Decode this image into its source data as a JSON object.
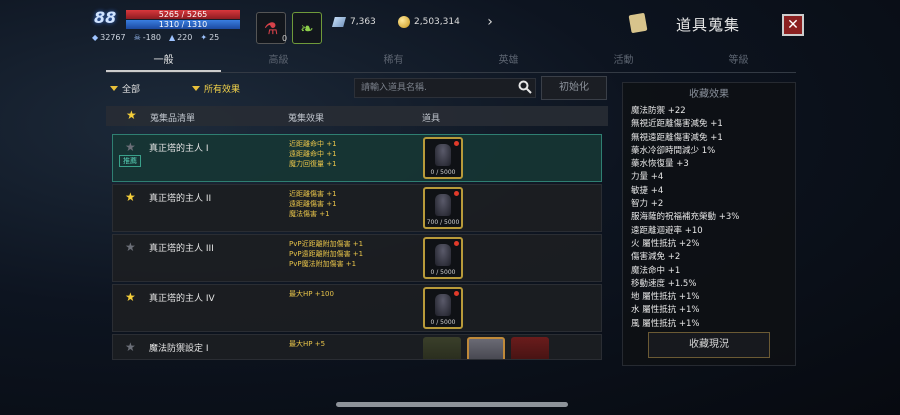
{
  "hud": {
    "level": "88",
    "hp": "5265 / 5265",
    "mp": "1310 / 1310",
    "stats": [
      "32767",
      "-180",
      "220",
      "25"
    ],
    "potion_count": "0",
    "currency_silver": "7,363",
    "currency_gold": "2,503,314"
  },
  "header": {
    "title": "道具蒐集",
    "close": "✕"
  },
  "tabs": [
    "一般",
    "高級",
    "稀有",
    "英雄",
    "活動",
    "等級"
  ],
  "filters": {
    "category": "全部",
    "effect": "所有效果"
  },
  "search": {
    "placeholder": "請輸入道具名稱.",
    "reset": "初始化"
  },
  "table": {
    "headers": {
      "list": "蒐集品清單",
      "effect": "蒐集效果",
      "item": "道具"
    },
    "rows": [
      {
        "name": "真正塔的主人 I",
        "starred": false,
        "badge": "推薦",
        "effects": [
          "近距離命中 +1",
          "遠距離命中 +1",
          "魔力回復量 +1"
        ],
        "progress": "0 / 5000"
      },
      {
        "name": "真正塔的主人 II",
        "starred": true,
        "badge": "",
        "effects": [
          "近距離傷害 +1",
          "遠距離傷害 +1",
          "魔法傷害 +1"
        ],
        "progress": "700 / 5000"
      },
      {
        "name": "真正塔的主人 III",
        "starred": false,
        "badge": "",
        "effects": [
          "PvP近距離附加傷害 +1",
          "PvP遠距離附加傷害 +1",
          "PvP魔法附加傷害 +1"
        ],
        "progress": "0 / 5000"
      },
      {
        "name": "真正塔的主人 IV",
        "starred": true,
        "badge": "",
        "effects": [
          "最大HP +100"
        ],
        "progress": "0 / 5000"
      },
      {
        "name": "魔法防禦設定 I",
        "starred": false,
        "badge": "",
        "effects": [
          "最大HP +5"
        ],
        "progress": ""
      }
    ]
  },
  "collection": {
    "title": "收藏效果",
    "effects": [
      "魔法防禦 +22",
      "無視近距離傷害減免 +1",
      "無視遠距離傷害減免 +1",
      "藥水冷卻時間減少 1%",
      "藥水恢復量 +3",
      "力量 +4",
      "敏捷 +4",
      "智力 +2",
      "服海薩的祝福補充榮動 +3%",
      "遠距離迴避率 +10",
      "火 屬性抵抗 +2%",
      "傷害減免 +2",
      "魔法命中 +1",
      "移動速度 +1.5%",
      "地 屬性抵抗 +1%",
      "水 屬性抵抗 +1%",
      "風 屬性抵抗 +1%"
    ],
    "button": "收藏現況"
  },
  "colors": {
    "accent_gold": "#f5cf3a",
    "selected_row": "#2f7f72",
    "hp": "#d8373c",
    "mp": "#3a7ee0"
  }
}
